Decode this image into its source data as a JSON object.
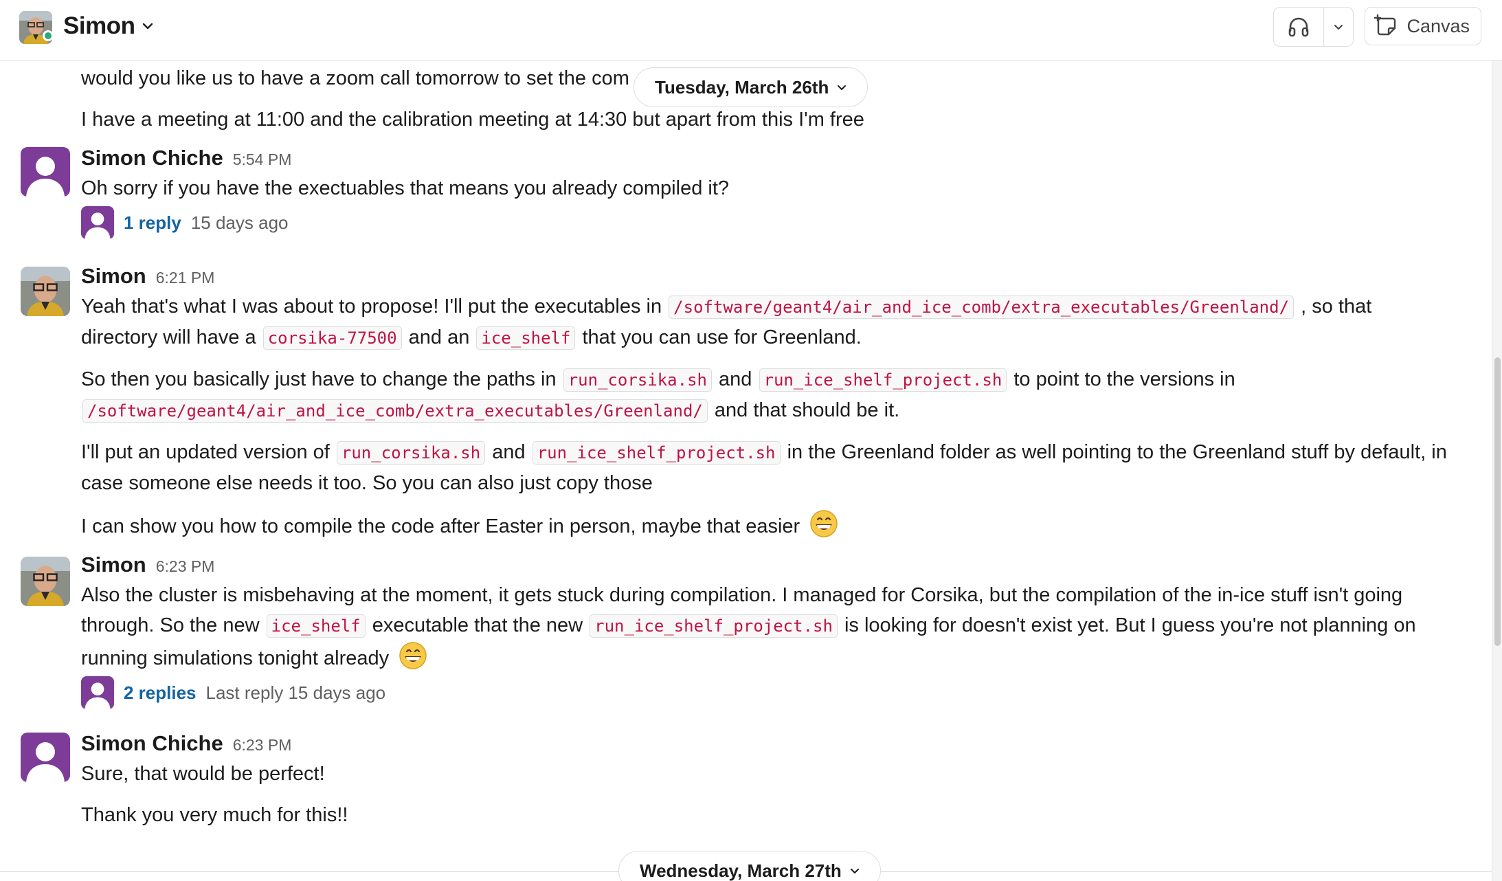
{
  "header": {
    "title": "Simon",
    "canvas_label": "Canvas"
  },
  "dividers": {
    "top_date": "Tuesday, March 26th",
    "bottom_date": "Wednesday, March 27th"
  },
  "prev": {
    "line1": "would you like us to have a zoom call tomorrow to set the com",
    "line2": "I have a meeting at 11:00 and the calibration meeting at 14:30 but apart from this I'm free"
  },
  "msg1": {
    "author": "Simon Chiche",
    "time": "5:54 PM",
    "text": "Oh sorry if you have the exectuables that means you already compiled it?",
    "reply_label": "1 reply",
    "reply_time": "15 days ago"
  },
  "msg2": {
    "author": "Simon",
    "time": "6:21 PM",
    "p1_a": "Yeah that's what I was about to propose! I'll put the executables in",
    "p1_code1": "/software/geant4/air_and_ice_comb/extra_executables/Greenland/",
    "p1_b": ", so that directory will have a",
    "p1_code2": "corsika-77500",
    "p1_c": "and an",
    "p1_code3": "ice_shelf",
    "p1_d": "that you can use for Greenland.",
    "p2_a": "So then you basically just have to change the paths in",
    "p2_code1": "run_corsika.sh",
    "p2_b": "and",
    "p2_code2": "run_ice_shelf_project.sh",
    "p2_c": "to point to the versions in",
    "p2_code3": "/software/geant4/air_and_ice_comb/extra_executables/Greenland/",
    "p2_d": "and that should be it.",
    "p3_a": "I'll put an updated version of",
    "p3_code1": "run_corsika.sh",
    "p3_b": "and",
    "p3_code2": "run_ice_shelf_project.sh",
    "p3_c": "in the Greenland folder as well pointing to the Greenland stuff by default, in case someone else needs it too. So you can also just copy those",
    "p4": "I can show you how to compile the code after Easter in person, maybe that easier"
  },
  "msg3": {
    "author": "Simon",
    "time": "6:23 PM",
    "a": "Also the cluster is misbehaving at the moment, it gets stuck during compilation. I managed for Corsika, but the compilation of the in-ice stuff isn't going through. So the new",
    "code1": "ice_shelf",
    "b": "executable that the new",
    "code2": "run_ice_shelf_project.sh",
    "c": "is looking for doesn't exist yet. But I guess you're not planning on running simulations tonight already",
    "reply_label": "2 replies",
    "reply_time": "Last reply 15 days ago"
  },
  "msg4": {
    "author": "Simon Chiche",
    "time": "6:23 PM",
    "line1": "Sure, that would be perfect!",
    "line2": "Thank you very much for this!!"
  },
  "colors": {
    "link": "#1264a3",
    "code_text": "#c01343",
    "default_avatar": "#7d3c98",
    "presence": "#2bac76"
  },
  "icons": [
    "chevron-down-icon",
    "headphones-icon",
    "canvas-icon",
    "grinning-emoji-icon",
    "default-user-icon"
  ]
}
